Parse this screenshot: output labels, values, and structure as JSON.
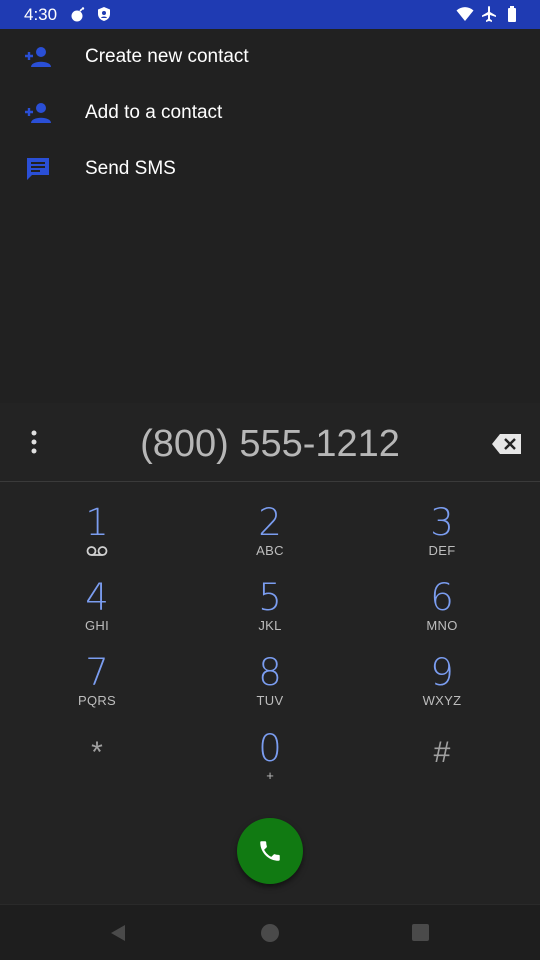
{
  "status_bar": {
    "time": "4:30",
    "background": "#1f3bb3",
    "left_icons": [
      "bomb-icon",
      "shield-icon"
    ],
    "right_icons": [
      "wifi-icon",
      "airplane-icon",
      "battery-icon"
    ]
  },
  "menu": {
    "items": [
      {
        "label": "Create new contact",
        "icon": "add-person-icon"
      },
      {
        "label": "Add to a contact",
        "icon": "add-person-icon"
      },
      {
        "label": "Send SMS",
        "icon": "message-icon"
      }
    ],
    "icon_color": "#2a4fd6"
  },
  "dialpad": {
    "number": "(800) 555-1212",
    "keys": [
      {
        "digit": "1",
        "letters": "",
        "extra": "voicemail-icon"
      },
      {
        "digit": "2",
        "letters": "ABC"
      },
      {
        "digit": "3",
        "letters": "DEF"
      },
      {
        "digit": "4",
        "letters": "GHI"
      },
      {
        "digit": "5",
        "letters": "JKL"
      },
      {
        "digit": "6",
        "letters": "MNO"
      },
      {
        "digit": "7",
        "letters": "PQRS"
      },
      {
        "digit": "8",
        "letters": "TUV"
      },
      {
        "digit": "9",
        "letters": "WXYZ"
      },
      {
        "digit": "*",
        "letters": ""
      },
      {
        "digit": "0",
        "letters": "+"
      },
      {
        "digit": "#",
        "letters": ""
      }
    ],
    "digit_color": "#7b9df0",
    "call_button_color": "#117a12"
  },
  "nav_bar": {
    "icons": [
      "back-icon",
      "home-icon",
      "recents-icon"
    ]
  }
}
